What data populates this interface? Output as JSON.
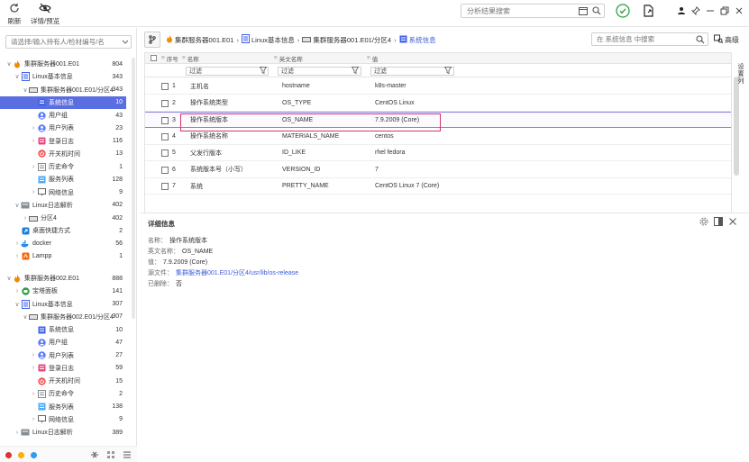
{
  "toolbar": {
    "refresh_label": "刷新",
    "detail_preview_label": "详情/预览",
    "search_placeholder": "分析结果搜索"
  },
  "sidebar": {
    "search_placeholder": "请选择/输入持有人/检材编号/名",
    "tree": [
      {
        "label": "集群服务器001.E01",
        "count": "804",
        "level": 0,
        "arrow": "v",
        "icon": "flame-icon"
      },
      {
        "label": "Linux基本信息",
        "count": "343",
        "level": 1,
        "arrow": "v",
        "icon": "doc-icon"
      },
      {
        "label": "集群服务器001.E01/分区4",
        "count": "343",
        "level": 2,
        "arrow": "v",
        "icon": "disk-icon"
      },
      {
        "label": "系统信息",
        "count": "10",
        "level": 3,
        "arrow": "",
        "icon": "sysinfo-icon",
        "selected": true
      },
      {
        "label": "用户组",
        "count": "43",
        "level": 3,
        "arrow": "",
        "icon": "user-icon"
      },
      {
        "label": "用户列表",
        "count": "23",
        "level": 3,
        "arrow": ">",
        "icon": "user-icon"
      },
      {
        "label": "登录日志",
        "count": "116",
        "level": 3,
        "arrow": ">",
        "icon": "log-icon"
      },
      {
        "label": "开关机时间",
        "count": "13",
        "level": 3,
        "arrow": "",
        "icon": "power-icon"
      },
      {
        "label": "历史命令",
        "count": "1",
        "level": 3,
        "arrow": ">",
        "icon": "history-icon"
      },
      {
        "label": "服务列表",
        "count": "128",
        "level": 3,
        "arrow": "",
        "icon": "service-icon"
      },
      {
        "label": "网络信息",
        "count": "9",
        "level": 3,
        "arrow": ">",
        "icon": "network-icon"
      },
      {
        "label": "Linux日志解析",
        "count": "402",
        "level": 1,
        "arrow": "v",
        "icon": "log-parse-icon"
      },
      {
        "label": "分区4",
        "count": "402",
        "level": 2,
        "arrow": ">",
        "icon": "disk-icon"
      },
      {
        "label": "桌面快捷方式",
        "count": "2",
        "level": 1,
        "arrow": "",
        "icon": "shortcut-icon"
      },
      {
        "label": "docker",
        "count": "56",
        "level": 1,
        "arrow": ">",
        "icon": "docker-icon"
      },
      {
        "label": "Lampp",
        "count": "1",
        "level": 1,
        "arrow": ">",
        "icon": "lampp-icon"
      },
      {
        "label": "集群服务器002.E01",
        "count": "888",
        "level": 0,
        "arrow": "v",
        "icon": "flame-icon",
        "gap": true
      },
      {
        "label": "宝塔面板",
        "count": "141",
        "level": 1,
        "arrow": ">",
        "icon": "panel-icon"
      },
      {
        "label": "Linux基本信息",
        "count": "307",
        "level": 1,
        "arrow": "v",
        "icon": "doc-icon"
      },
      {
        "label": "集群服务器002.E01/分区4",
        "count": "307",
        "level": 2,
        "arrow": "v",
        "icon": "disk-icon"
      },
      {
        "label": "系统信息",
        "count": "10",
        "level": 3,
        "arrow": "",
        "icon": "sysinfo-icon"
      },
      {
        "label": "用户组",
        "count": "47",
        "level": 3,
        "arrow": "",
        "icon": "user-icon"
      },
      {
        "label": "用户列表",
        "count": "27",
        "level": 3,
        "arrow": ">",
        "icon": "user-icon"
      },
      {
        "label": "登录日志",
        "count": "59",
        "level": 3,
        "arrow": ">",
        "icon": "log-icon"
      },
      {
        "label": "开关机时间",
        "count": "15",
        "level": 3,
        "arrow": "",
        "icon": "power-icon"
      },
      {
        "label": "历史命令",
        "count": "2",
        "level": 3,
        "arrow": ">",
        "icon": "history-icon"
      },
      {
        "label": "服务列表",
        "count": "138",
        "level": 3,
        "arrow": "",
        "icon": "service-icon"
      },
      {
        "label": "网络信息",
        "count": "9",
        "level": 3,
        "arrow": ">",
        "icon": "network-icon"
      },
      {
        "label": "Linux日志解析",
        "count": "389",
        "level": 1,
        "arrow": ">",
        "icon": "log-parse-icon"
      }
    ]
  },
  "breadcrumb": {
    "items": [
      "集群服务器001.E01",
      "Linux基本信息",
      "集群服务器001.E01/分区4",
      "系统信息"
    ]
  },
  "table_search_placeholder": "在 系统信息 中搜索",
  "advanced_label": "高级",
  "side_tab_label": [
    "设",
    "置",
    "列"
  ],
  "table": {
    "headers": {
      "index": "序号",
      "name": "名称",
      "en_name": "英文名称",
      "value": "值"
    },
    "filter_placeholder": "过滤",
    "rows": [
      {
        "index": "1",
        "name": "主机名",
        "en_name": "hostname",
        "value": "k8s-master"
      },
      {
        "index": "2",
        "name": "操作系统类型",
        "en_name": "OS_TYPE",
        "value": "CentOS Linux"
      },
      {
        "index": "3",
        "name": "操作系统版本",
        "en_name": "OS_NAME",
        "value": "7.9.2009 (Core)"
      },
      {
        "index": "4",
        "name": "操作系统名称",
        "en_name": "MATERIALS_NAME",
        "value": "centos"
      },
      {
        "index": "5",
        "name": "父发行版本",
        "en_name": "ID_LIKE",
        "value": "rhel fedora"
      },
      {
        "index": "6",
        "name": "系统版本号（小写）",
        "en_name": "VERSION_ID",
        "value": "7"
      },
      {
        "index": "7",
        "name": "系统",
        "en_name": "PRETTY_NAME",
        "value": "CentOS Linux 7 (Core)"
      }
    ]
  },
  "detail": {
    "title": "详细信息",
    "fields": [
      {
        "key": "名称：",
        "value": "操作系统版本"
      },
      {
        "key": "英文名称：",
        "value": "OS_NAME"
      },
      {
        "key": "值：",
        "value": "7.9.2009 (Core)"
      },
      {
        "key": "源文件：",
        "value": "集群服务器001.E01/分区4/usr/lib/os-release",
        "link": true
      },
      {
        "key": "已删除：",
        "value": "否"
      }
    ]
  },
  "colors": {
    "accent": "#5b6ee1",
    "highlight_border": "#d6336c",
    "link": "#3b5bdb"
  }
}
